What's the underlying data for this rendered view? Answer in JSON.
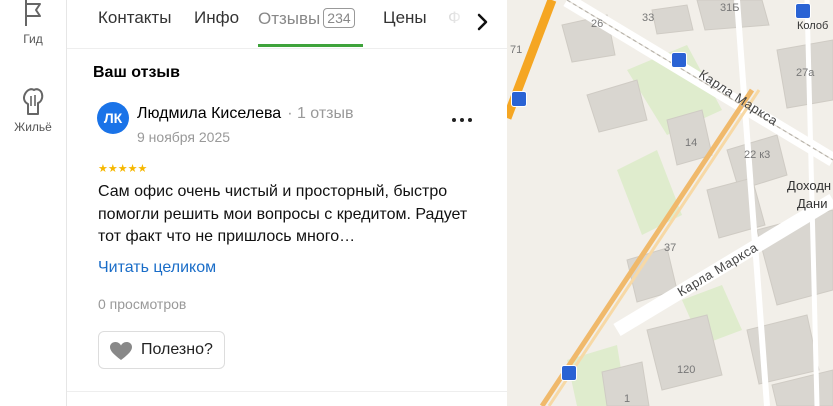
{
  "rail": {
    "items": [
      {
        "label": "Гид",
        "icon": "flag-icon"
      },
      {
        "label": "Жильё",
        "icon": "hand-icon"
      }
    ]
  },
  "tabs": [
    {
      "label": "Контакты"
    },
    {
      "label": "Инфо"
    },
    {
      "label": "Отзывы",
      "count": "234",
      "active": true
    },
    {
      "label": "Цены"
    },
    {
      "label": "Ф"
    }
  ],
  "review": {
    "section_title": "Ваш отзыв",
    "avatar_initials": "ЛК",
    "avatar_color": "#1a73e8",
    "author_name": "Людмила Киселева",
    "author_meta": "· 1 отзыв",
    "date": "9 ноября 2025",
    "rating": 5,
    "stars": "★★★★★",
    "text": "Сам офис очень чистый и просторный, быстро помогли решить мои вопросы с кредитом. Радует тот факт что не пришлось много…",
    "read_more": "Читать целиком",
    "views": "0 просмотров",
    "useful_label": "Полезно?"
  },
  "map": {
    "street_labels": [
      "Карла Маркса",
      "Карла Маркса"
    ],
    "building_numbers": [
      "31Б",
      "33",
      "26",
      "71",
      "27а",
      "14",
      "22 к3",
      "37",
      "120",
      "1"
    ],
    "poi_labels": [
      "Колоб",
      "Доходн",
      "Дани"
    ],
    "accent_road_color": "#f5a623",
    "tram_color": "#2a63d4"
  }
}
